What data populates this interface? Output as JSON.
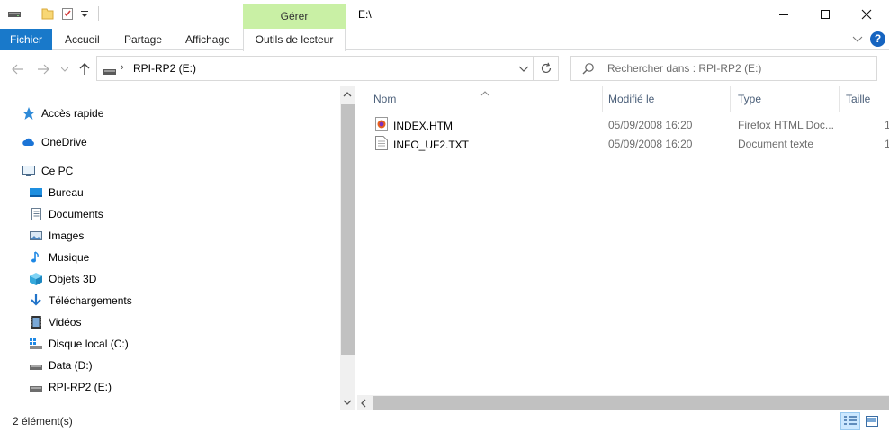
{
  "window": {
    "title": "E:\\",
    "context_tab_group": "Gérer",
    "minimize_glyph": "—",
    "maximize_glyph": "☐",
    "close_glyph": "✕"
  },
  "ribbon": {
    "tabs": [
      {
        "label": "Fichier"
      },
      {
        "label": "Accueil"
      },
      {
        "label": "Partage"
      },
      {
        "label": "Affichage"
      },
      {
        "label": "Outils de lecteur"
      }
    ],
    "help": "?"
  },
  "address": {
    "path": "RPI-RP2 (E:)",
    "separator": "›"
  },
  "search": {
    "placeholder": "Rechercher dans : RPI-RP2 (E:)"
  },
  "nav_pane": {
    "items": [
      {
        "label": "Accès rapide",
        "icon": "star-icon"
      },
      {
        "label": "OneDrive",
        "icon": "cloud-icon"
      },
      {
        "label": "Ce PC",
        "icon": "computer-icon"
      },
      {
        "label": "Bureau",
        "icon": "desktop-icon"
      },
      {
        "label": "Documents",
        "icon": "documents-icon"
      },
      {
        "label": "Images",
        "icon": "images-icon"
      },
      {
        "label": "Musique",
        "icon": "music-icon"
      },
      {
        "label": "Objets 3D",
        "icon": "cube-icon"
      },
      {
        "label": "Téléchargements",
        "icon": "download-icon"
      },
      {
        "label": "Vidéos",
        "icon": "video-icon"
      },
      {
        "label": "Disque local (C:)",
        "icon": "windows-drive-icon"
      },
      {
        "label": "Data (D:)",
        "icon": "drive-icon"
      },
      {
        "label": "RPI-RP2 (E:)",
        "icon": "drive-icon"
      }
    ]
  },
  "columns": [
    {
      "label": "Nom"
    },
    {
      "label": "Modifié le"
    },
    {
      "label": "Type"
    },
    {
      "label": "Taille"
    }
  ],
  "files": [
    {
      "name": "INDEX.HTM",
      "date": "05/09/2008 16:20",
      "type": "Firefox HTML Doc...",
      "size": "1",
      "icon": "firefox-html-icon"
    },
    {
      "name": "INFO_UF2.TXT",
      "date": "05/09/2008 16:20",
      "type": "Document texte",
      "size": "1",
      "icon": "text-file-icon"
    }
  ],
  "status": {
    "count": "2 élément(s)"
  },
  "colors": {
    "file_tab": "#1979ca",
    "context_tab": "#c9f0a5",
    "selected_view": "#cce8ff",
    "column_header_text": "#4c607a"
  }
}
